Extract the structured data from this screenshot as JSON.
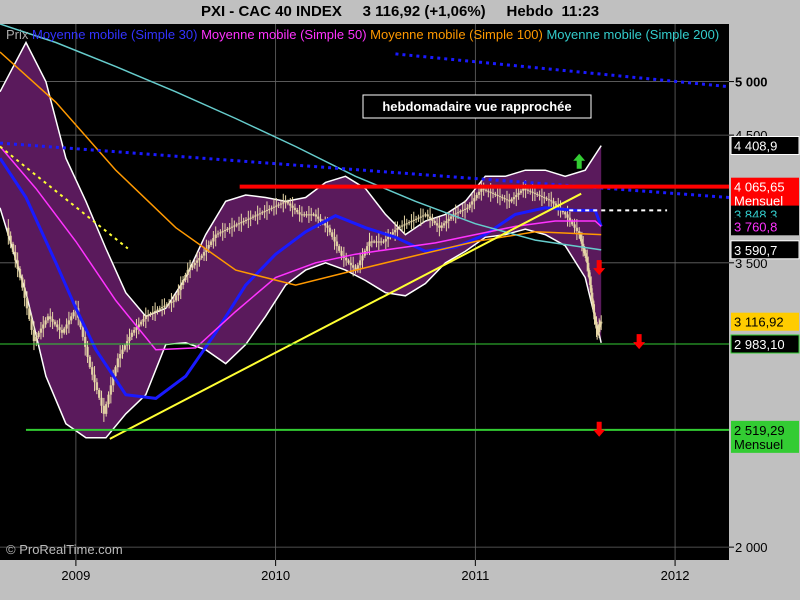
{
  "header": {
    "title": "PXI - CAC 40 INDEX     3 116,92 (+1,06%)     Hebdo  11:23"
  },
  "legend": {
    "prefix": "Prix",
    "items": [
      {
        "label": "Moyenne mobile (Simple 30)",
        "color": "#3333ff"
      },
      {
        "label": "Moyenne mobile (Simple 50)",
        "color": "#ff33ff"
      },
      {
        "label": "Moyenne mobile (Simple 100)",
        "color": "#ff9900"
      },
      {
        "label": "Moyenne mobile (Simple 200)",
        "color": "#33cccc"
      }
    ]
  },
  "annotation": "hebdomadaire vue rapprochée",
  "copyright": "© ProRealTime.com",
  "colors": {
    "background": "#000000",
    "panel": "#c0c0c0",
    "bollinger_fill": "#5a1a5c",
    "bollinger_edge": "#ffffff",
    "candle": "#e8d8a8",
    "sma30": "#1a1aff",
    "sma50": "#ff33ff",
    "sma100": "#ff9900",
    "sma200": "#66cccc",
    "resistance": "#ff0000",
    "support": "#33cc33",
    "trendline": "#ffff33",
    "dotted_downtrend": "#1a1aff",
    "arrow_up": "#33cc33",
    "arrow_down": "#ff0000"
  },
  "chart_data": {
    "type": "line",
    "title": "PXI - CAC 40 INDEX",
    "timeframe": "Hebdo",
    "last_price": "3 116,92",
    "change": "+1,06%",
    "time": "11:23",
    "y_scale": "log",
    "ylim": [
      1950,
      5600
    ],
    "y_ticks": [
      {
        "value": 5000,
        "label": "5 000"
      },
      {
        "value": 4500,
        "label": "4 500"
      },
      {
        "value": 3500,
        "label": "3 500"
      },
      {
        "value": 2000,
        "label": "2 000"
      }
    ],
    "x_ticks": [
      {
        "value": 2009.0,
        "label": "2009"
      },
      {
        "value": 2010.0,
        "label": "2010"
      },
      {
        "value": 2011.0,
        "label": "2011"
      },
      {
        "value": 2012.0,
        "label": "2012"
      }
    ],
    "xlim": [
      2008.62,
      2012.27
    ],
    "price_labels": [
      {
        "value": 4408.9,
        "label": "4 408,9",
        "bg": "#000000",
        "fg": "#ffffff",
        "border": "#ffffff"
      },
      {
        "value": 4065.65,
        "label": "4 065,65",
        "sublabel": "Mensuel",
        "bg": "#ff0000",
        "fg": "#ffffff"
      },
      {
        "value": 3848.3,
        "label": "3 848,3",
        "bg": "#000000",
        "fg": "#33cccc"
      },
      {
        "value": 3760.8,
        "label": "3 760,8",
        "bg": "#000000",
        "fg": "#ff33ff"
      },
      {
        "value": 3590.7,
        "label": "3 590,7",
        "bg": "#000000",
        "fg": "#ffffff",
        "border": "#ffffff"
      },
      {
        "value": 3116.92,
        "label": "3 116,92",
        "bg": "#ffcc00",
        "fg": "#000000"
      },
      {
        "value": 2983.1,
        "label": "2 983,10",
        "bg": "#000000",
        "fg": "#ffffff",
        "border": "#33cc33"
      },
      {
        "value": 2519.29,
        "label": "2 519,29",
        "sublabel": "Mensuel",
        "bg": "#33cc33",
        "fg": "#000000"
      }
    ],
    "horizontal_lines": [
      {
        "name": "Mensuel resistance",
        "value": 4065.65,
        "from": 2009.82,
        "color": "#ff0000",
        "width": 4
      },
      {
        "name": "Mensuel support",
        "value": 2519.29,
        "from": 2008.75,
        "color": "#33cc33",
        "width": 2
      },
      {
        "name": "2 983,10",
        "value": 2983.1,
        "from": 2008.62,
        "color": "#33cc33",
        "width": 1
      },
      {
        "name": "dotted level",
        "value": 3880,
        "from": 2011.47,
        "to": 2011.96,
        "color": "#ffffff",
        "width": 2,
        "dash": true
      }
    ],
    "trendlines": [
      {
        "name": "uptrend",
        "color": "#ffff33",
        "points": [
          [
            2009.17,
            2475
          ],
          [
            2011.53,
            4010
          ]
        ],
        "width": 2
      },
      {
        "name": "dotted downtrend long",
        "color": "#1a1aff",
        "points": [
          [
            2008.62,
            4430
          ],
          [
            2012.27,
            3980
          ]
        ],
        "width": 3,
        "dash": true
      },
      {
        "name": "dotted downtrend top",
        "color": "#1a1aff",
        "points": [
          [
            2010.6,
            5280
          ],
          [
            2012.27,
            4950
          ]
        ],
        "width": 3,
        "dash": true
      },
      {
        "name": "dotted yellow",
        "color": "#ffff33",
        "points": [
          [
            2008.62,
            4400
          ],
          [
            2009.26,
            3600
          ]
        ],
        "width": 2,
        "dash": true
      }
    ],
    "close_series": {
      "x": [
        2008.65,
        2008.72,
        2008.79,
        2008.86,
        2008.93,
        2009.0,
        2009.07,
        2009.14,
        2009.21,
        2009.28,
        2009.35,
        2009.42,
        2009.49,
        2009.56,
        2009.63,
        2009.7,
        2009.77,
        2009.84,
        2009.91,
        2009.98,
        2010.05,
        2010.12,
        2010.19,
        2010.26,
        2010.33,
        2010.4,
        2010.47,
        2010.54,
        2010.61,
        2010.68,
        2010.75,
        2010.82,
        2010.89,
        2010.96,
        2011.03,
        2011.1,
        2011.17,
        2011.24,
        2011.31,
        2011.38,
        2011.45,
        2011.52,
        2011.56,
        2011.59,
        2011.61,
        2011.63
      ],
      "y": [
        3750,
        3400,
        3000,
        3150,
        3050,
        3200,
        2850,
        2600,
        2900,
        3050,
        3150,
        3200,
        3250,
        3450,
        3550,
        3700,
        3750,
        3800,
        3850,
        3900,
        3950,
        3850,
        3850,
        3750,
        3550,
        3450,
        3650,
        3650,
        3750,
        3800,
        3850,
        3750,
        3850,
        3900,
        4050,
        4000,
        3950,
        4050,
        4000,
        3950,
        3850,
        3700,
        3500,
        3200,
        3050,
        3117
      ]
    },
    "series": [
      {
        "name": "Moyenne mobile (Simple 30)",
        "color": "#1a1aff",
        "x": [
          2008.62,
          2008.75,
          2008.9,
          2009.0,
          2009.1,
          2009.25,
          2009.4,
          2009.55,
          2009.7,
          2009.85,
          2010.0,
          2010.15,
          2010.3,
          2010.45,
          2010.6,
          2010.75,
          2010.9,
          2011.05,
          2011.2,
          2011.35,
          2011.5,
          2011.6,
          2011.63
        ],
        "y": [
          4300,
          3980,
          3500,
          3200,
          2950,
          2700,
          2680,
          2800,
          3050,
          3350,
          3560,
          3720,
          3840,
          3750,
          3680,
          3580,
          3610,
          3700,
          3850,
          3900,
          3880,
          3880,
          3760
        ]
      },
      {
        "name": "Moyenne mobile (Simple 50)",
        "color": "#ff33ff",
        "x": [
          2008.62,
          2008.8,
          2009.0,
          2009.2,
          2009.4,
          2009.6,
          2009.8,
          2010.0,
          2010.2,
          2010.4,
          2010.6,
          2010.8,
          2011.0,
          2011.2,
          2011.4,
          2011.6,
          2011.63
        ],
        "y": [
          4400,
          4050,
          3650,
          3250,
          2950,
          2960,
          3180,
          3400,
          3500,
          3560,
          3600,
          3640,
          3700,
          3760,
          3800,
          3800,
          3760
        ]
      },
      {
        "name": "Moyenne mobile (Simple 100)",
        "color": "#ff9900",
        "x": [
          2008.62,
          2008.9,
          2009.2,
          2009.5,
          2009.8,
          2010.1,
          2010.4,
          2010.7,
          2011.0,
          2011.3,
          2011.63
        ],
        "y": [
          5300,
          4800,
          4200,
          3750,
          3450,
          3350,
          3450,
          3550,
          3650,
          3720,
          3700
        ]
      },
      {
        "name": "Moyenne mobile (Simple 200)",
        "color": "#66cccc",
        "x": [
          2008.62,
          2008.9,
          2009.2,
          2009.5,
          2009.8,
          2010.1,
          2010.4,
          2010.7,
          2011.0,
          2011.3,
          2011.63
        ],
        "y": [
          5600,
          5400,
          5150,
          4900,
          4650,
          4400,
          4150,
          3950,
          3780,
          3660,
          3590
        ]
      }
    ],
    "bollinger_upper": {
      "x": [
        2008.62,
        2008.75,
        2008.85,
        2008.95,
        2009.05,
        2009.15,
        2009.25,
        2009.35,
        2009.45,
        2009.55,
        2009.65,
        2009.75,
        2009.85,
        2009.95,
        2010.05,
        2010.15,
        2010.25,
        2010.35,
        2010.45,
        2010.55,
        2010.65,
        2010.75,
        2010.85,
        2010.95,
        2011.05,
        2011.15,
        2011.25,
        2011.35,
        2011.45,
        2011.55,
        2011.63
      ],
      "y": [
        4900,
        5400,
        5000,
        4300,
        3950,
        3600,
        3300,
        3150,
        3200,
        3400,
        3700,
        3950,
        4000,
        3980,
        3950,
        3980,
        4100,
        4150,
        4050,
        3850,
        3700,
        3800,
        3850,
        3950,
        4150,
        4150,
        4200,
        4200,
        4150,
        4200,
        4408
      ]
    },
    "bollinger_lower": {
      "x": [
        2008.62,
        2008.75,
        2008.85,
        2008.95,
        2009.05,
        2009.15,
        2009.25,
        2009.35,
        2009.45,
        2009.55,
        2009.65,
        2009.75,
        2009.85,
        2009.95,
        2010.05,
        2010.15,
        2010.25,
        2010.35,
        2010.45,
        2010.55,
        2010.65,
        2010.75,
        2010.85,
        2010.95,
        2011.05,
        2011.15,
        2011.25,
        2011.35,
        2011.45,
        2011.55,
        2011.63
      ],
      "y": [
        3900,
        3300,
        2800,
        2550,
        2480,
        2480,
        2600,
        2700,
        2980,
        2990,
        2950,
        2870,
        2980,
        3150,
        3350,
        3450,
        3500,
        3450,
        3380,
        3300,
        3280,
        3360,
        3500,
        3580,
        3680,
        3700,
        3740,
        3700,
        3620,
        3400,
        2990
      ]
    },
    "arrows": [
      {
        "dir": "up",
        "x": 2011.52,
        "y": 4270
      },
      {
        "dir": "down",
        "x": 2011.62,
        "y": 3470
      },
      {
        "dir": "down",
        "x": 2011.82,
        "y": 3000
      },
      {
        "dir": "down",
        "x": 2011.62,
        "y": 2525
      }
    ]
  }
}
